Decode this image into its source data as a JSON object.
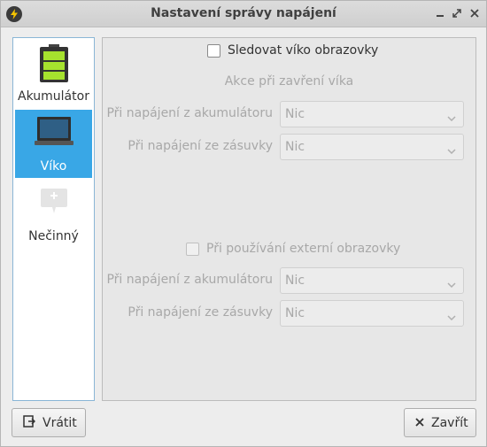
{
  "window": {
    "title": "Nastavení správy napájení"
  },
  "sidebar": {
    "items": [
      {
        "label": "Akumulátor",
        "icon": "battery-icon",
        "active": false
      },
      {
        "label": "Víko",
        "icon": "laptop-lid-icon",
        "active": true
      },
      {
        "label": "Nečinný",
        "icon": "idle-monitor-icon",
        "active": false
      }
    ]
  },
  "lid": {
    "watch_lid_label": "Sledovat víko obrazovky",
    "watch_lid_checked": false,
    "section_title": "Akce při zavření víka",
    "battery_label": "Při napájení z akumulátoru",
    "battery_value": "Nic",
    "ac_label": "Při napájení ze zásuvky",
    "ac_value": "Nic",
    "external_label": "Při používání externí obrazovky",
    "external_checked": false,
    "ext_battery_label": "Při napájení z akumulátoru",
    "ext_battery_value": "Nic",
    "ext_ac_label": "Při napájení ze zásuvky",
    "ext_ac_value": "Nic"
  },
  "buttons": {
    "revert": "Vrátit",
    "close": "Zavřít"
  },
  "colors": {
    "accent": "#39a7e6",
    "battery_green": "#a6e22e"
  }
}
